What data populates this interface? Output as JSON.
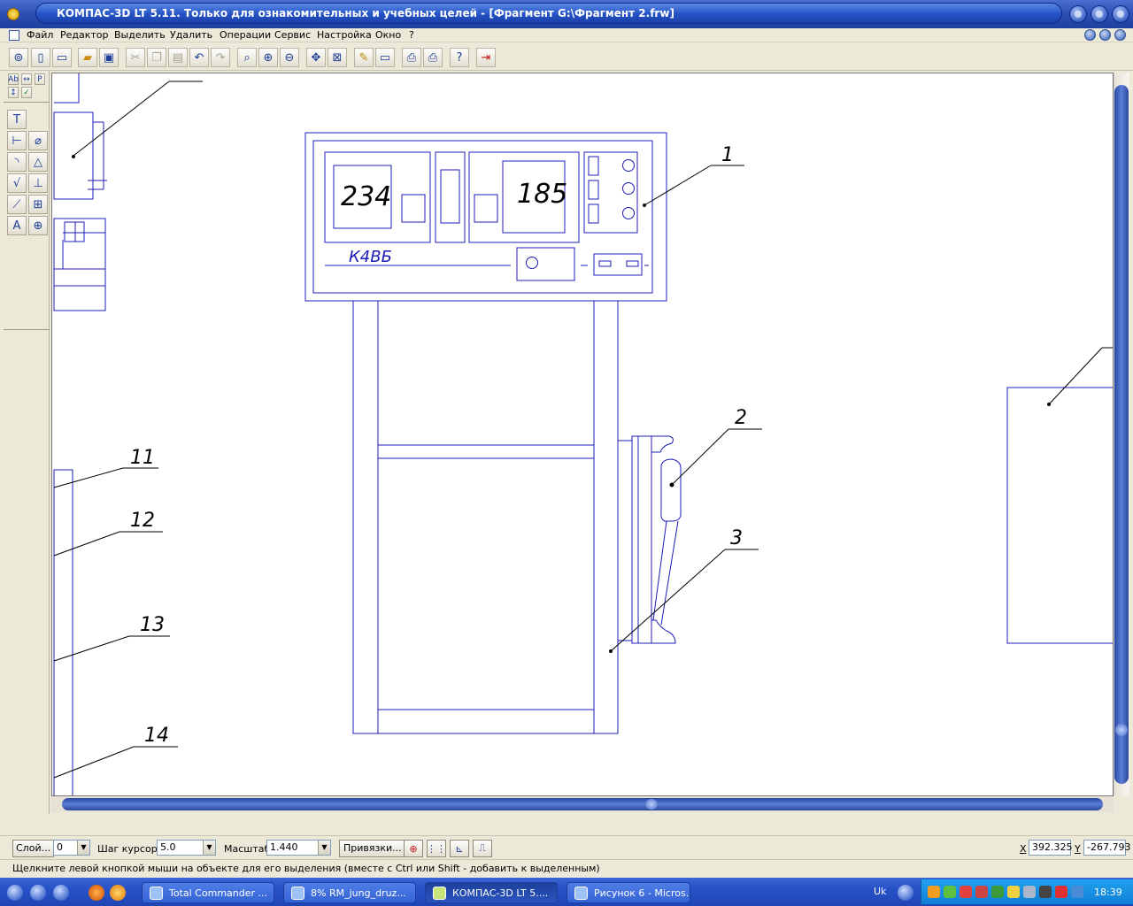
{
  "window": {
    "title": "КОМПАС-3D LT 5.11. Только для ознакомительных и учебных целей - [Фрагмент G:\\Фрагмент 2.frw]"
  },
  "menu": {
    "items": [
      "Файл",
      "Редактор",
      "Выделить",
      "Удалить",
      "Операции",
      "Сервис",
      "Настройка",
      "Окно",
      "?"
    ]
  },
  "toolbar": {
    "icons": [
      "preview-icon",
      "new-sheet-icon",
      "new-file-icon",
      "open-icon",
      "save-icon",
      "cut-icon",
      "copy-icon",
      "paste-icon",
      "undo-icon",
      "redo-icon",
      "zoom-icon",
      "zoom-in-icon",
      "zoom-out-icon",
      "pan-icon",
      "zoom-all-icon",
      "edit-icon",
      "monitor-icon",
      "print-preview-icon",
      "print-icon",
      "help-cursor-icon",
      "exit-icon"
    ]
  },
  "left_panel": {
    "small_tabs": [
      "Ab",
      "Р"
    ],
    "tools": [
      "text-tool",
      "dimension-tool",
      "diameter-tool",
      "radius-tool",
      "angle-tool",
      "roughness-tool",
      "base-tool",
      "leader-tool",
      "table-tool",
      "label-tool",
      "point-tool"
    ]
  },
  "drawing": {
    "panel_numbers": [
      "234",
      "185"
    ],
    "panel_label": "К4ВБ",
    "callouts": [
      "1",
      "2",
      "3",
      "11",
      "12",
      "13",
      "14"
    ],
    "stroke_color": "#1c1cb4"
  },
  "statusbar": {
    "layer_label": "Слой...",
    "layer_value": "0",
    "step_label": "Шаг курсора",
    "step_value": "5.0",
    "scale_label": "Масштаб",
    "scale_value": "1.440",
    "snap_button": "Привязки...",
    "x_label": "X",
    "x_value": "392.325",
    "y_label": "Y",
    "y_value": "-267.793"
  },
  "hint": {
    "text": "Щелкните левой кнопкой мыши на объекте для его выделения (вместе с Ctrl или Shift - добавить к выделенным)"
  },
  "taskbar": {
    "tasks": [
      {
        "label": "Total Commander ..."
      },
      {
        "label": "8% RM_jung_druz..."
      },
      {
        "label": "КОМПАС-3D LT 5...."
      },
      {
        "label": "Рисунок 6 - Micros..."
      }
    ],
    "language": "Uk",
    "clock": "18:39"
  }
}
